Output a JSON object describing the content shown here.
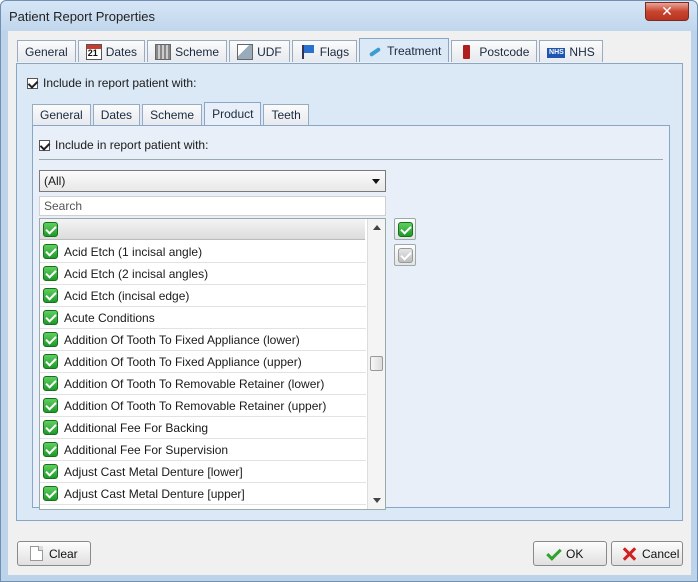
{
  "window": {
    "title": "Patient Report Properties",
    "close_label": "✕"
  },
  "outer_tabs": [
    {
      "label": "General",
      "icon": "none"
    },
    {
      "label": "Dates",
      "icon": "calendar-icon"
    },
    {
      "label": "Scheme",
      "icon": "scheme-icon"
    },
    {
      "label": "UDF",
      "icon": "udf-icon"
    },
    {
      "label": "Flags",
      "icon": "flag-icon"
    },
    {
      "label": "Treatment",
      "icon": "treatment-icon",
      "active": true
    },
    {
      "label": "Postcode",
      "icon": "postcode-icon"
    },
    {
      "label": "NHS",
      "icon": "nhs-icon",
      "icon_text": "NHS"
    }
  ],
  "outer_include": {
    "label": "Include in report patient with:",
    "checked": true
  },
  "inner_tabs": [
    {
      "label": "General"
    },
    {
      "label": "Dates"
    },
    {
      "label": "Scheme"
    },
    {
      "label": "Product",
      "active": true
    },
    {
      "label": "Teeth"
    }
  ],
  "inner_include": {
    "label": "Include in report patient with:",
    "checked": true
  },
  "filter": {
    "selected": "(All)"
  },
  "search": {
    "placeholder": "Search",
    "value": ""
  },
  "products": [
    "Acid Etch (1 incisal angle)",
    "Acid Etch (2 incisal angles)",
    "Acid Etch (incisal edge)",
    "Acute Conditions",
    "Addition Of Tooth To Fixed Appliance (lower)",
    "Addition Of Tooth To Fixed Appliance (upper)",
    "Addition Of Tooth To Removable Retainer (lower)",
    "Addition Of Tooth To Removable Retainer (upper)",
    "Additional Fee For Backing",
    "Additional Fee For Supervision",
    "Adjust Cast Metal Denture [lower]",
    "Adjust Cast Metal Denture [upper]"
  ],
  "buttons": {
    "clear": "Clear",
    "ok": "OK",
    "cancel": "Cancel"
  }
}
